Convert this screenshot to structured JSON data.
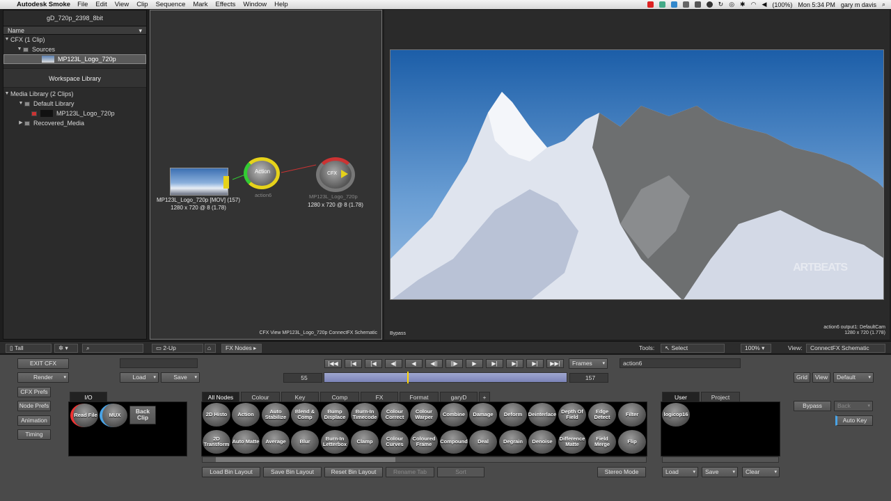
{
  "menubar": {
    "app_name": "Autodesk Smoke",
    "items": [
      "File",
      "Edit",
      "View",
      "Clip",
      "Sequence",
      "Mark",
      "Effects",
      "Window",
      "Help"
    ],
    "clock": "Mon 5:34 PM",
    "user": "gary m davis",
    "battery": "(100%)"
  },
  "left_panel": {
    "title": "gD_720p_2398_8bit",
    "header": "Name",
    "cfx_group": "CFX (1 Clip)",
    "sources": "Sources",
    "selected_clip": "MP123L_Logo_720p",
    "workspace_library": "Workspace Library",
    "media_library": "Media Library (2 Clips)",
    "default_library": "Default Library",
    "library_clip": "MP123L_Logo_720p",
    "recovered_media": "Recovered_Media"
  },
  "schematic": {
    "source_node_label": "MP123L_Logo_720p [MOV] (157)",
    "source_node_res": "1280 x 720 @ 8 (1.78)",
    "action_node_label": "Action",
    "action_node_sub": "action6",
    "cfx_node_label": "CFX",
    "cfx_node_sub": "MP123L_Logo_720p",
    "cfx_node_res": "1280 x 720 @ 8 (1.78)",
    "caption": "CFX View MP123L_Logo_720p ConnectFX Schematic"
  },
  "viewer": {
    "bypass": "Bypass",
    "info_line1": "action6 output1: DefaultCam",
    "info_line2": "1280 x 720 (1.778)",
    "watermark": "ARTBEATS"
  },
  "toolbar": {
    "layout_tall": "Tall",
    "view_mode": "2-Up",
    "fx_nodes": "FX Nodes",
    "tools_label": "Tools:",
    "tools_value": "Select",
    "zoom": "100%",
    "view_label": "View:",
    "view_value": "ConnectFX Schematic"
  },
  "controls": {
    "exit_cfx": "EXIT CFX",
    "render": "Render",
    "load": "Load",
    "save": "Save",
    "frames": "Frames",
    "node_name": "action6",
    "in_frame": "55",
    "out_frame": "157",
    "grid": "Grid",
    "view": "View",
    "default": "Default",
    "cfx_prefs": "CFX Prefs",
    "node_prefs": "Node Prefs",
    "animation": "Animation",
    "timing": "Timing",
    "bypass": "Bypass",
    "back": "Back",
    "auto_key": "Auto Key",
    "stereo_mode": "Stereo Mode",
    "load2": "Load",
    "save2": "Save",
    "clear": "Clear"
  },
  "io_bin": {
    "tab": "I/O",
    "nodes": [
      "Read File",
      "MUX",
      "Back Clip"
    ]
  },
  "node_bin": {
    "tabs": [
      "All Nodes",
      "Colour",
      "Key",
      "Comp",
      "FX",
      "Format",
      "garyD",
      "+"
    ],
    "row1": [
      "2D Histo",
      "Action",
      "Auto Stabilize",
      "Blend & Comp",
      "Bump Displace",
      "Burn-In Timecode",
      "Colour Correct",
      "Colour Warper",
      "Combine",
      "Damage",
      "Deform",
      "Deinterlace",
      "Depth Of Field",
      "Edge Detect",
      "Filter"
    ],
    "row2": [
      "2D Transform",
      "Auto Matte",
      "Average",
      "Blur",
      "Burn-In Letterbox",
      "Clamp",
      "Colour Curves",
      "Coloured Frame",
      "Compound",
      "Deal",
      "Degrain",
      "Denoise",
      "Difference Matte",
      "Field Merge",
      "Flip"
    ],
    "buttons": [
      "Load Bin Layout",
      "Save Bin Layout",
      "Reset Bin Layout",
      "Rename Tab",
      "Sort"
    ]
  },
  "user_bin": {
    "tabs": [
      "User",
      "Project"
    ],
    "nodes": [
      "logicop16"
    ]
  }
}
